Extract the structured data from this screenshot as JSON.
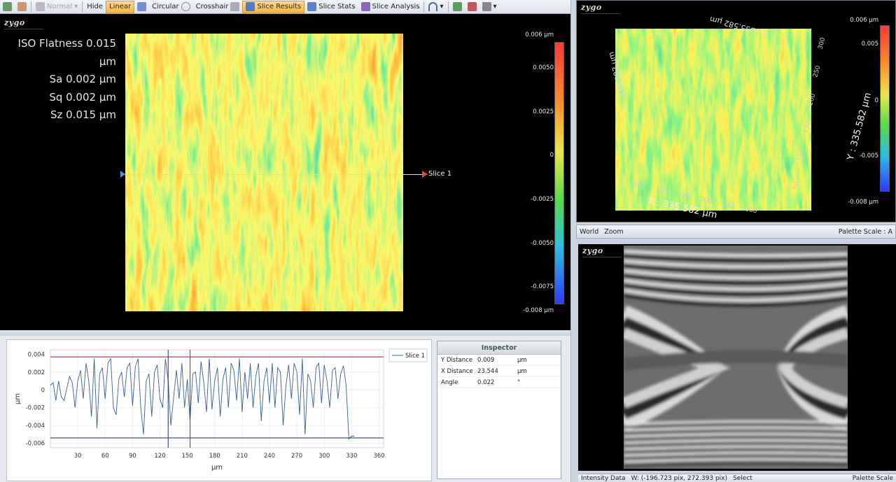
{
  "toolbar": {
    "normal_label": "Normal",
    "hide_label": "Hide",
    "linear_label": "Linear",
    "circular_label": "Circular",
    "crosshair_label": "Crosshair",
    "slice_results_label": "Slice Results",
    "slice_stats_label": "Slice Stats",
    "slice_analysis_label": "Slice Analysis"
  },
  "view2d": {
    "logo": "zygo",
    "stats": [
      "ISO Flatness 0.015 µm",
      "Sa 0.002 µm",
      "Sq 0.002 µm",
      "Sz 0.015 µm"
    ],
    "slice_label": "Slice 1",
    "colorbar_labels": [
      "0.006 µm",
      "0.0050",
      "0.0025",
      "0",
      "-0.0025",
      "-0.0050",
      "-0.0075",
      "-0.008 µm"
    ]
  },
  "view3d": {
    "logo": "zygo",
    "x_axis_title": "X : 335.582 µm",
    "y_axis_title": "Y : 335.582 µm",
    "x_ticks": [
      "50",
      "100",
      "150",
      "200",
      "250",
      "300"
    ],
    "y_ticks": [
      "50",
      "100",
      "150",
      "200",
      "250",
      "300"
    ],
    "colorbar_labels": [
      "0.006 µm",
      "0.005",
      "0",
      "-0.005",
      "-0.008 µm"
    ],
    "status": {
      "world": "World",
      "zoom": "Zoom",
      "palette": "Palette Scale : A"
    }
  },
  "intensity": {
    "logo": "zygo",
    "status": {
      "label": "Intensity Data",
      "coords": "W: (-196.723 pix, 272.393 pix)",
      "select": "Select",
      "palette": "Palette Scale"
    }
  },
  "inspector": {
    "title": "Inspector",
    "rows": [
      {
        "name": "Y Distance",
        "value": "0.009",
        "unit": "µm"
      },
      {
        "name": "X Distance",
        "value": "23.544",
        "unit": "µm"
      },
      {
        "name": "Angle",
        "value": "0.022",
        "unit": "°"
      }
    ]
  },
  "chart_data": {
    "type": "line",
    "title": "",
    "xlabel": "µm",
    "ylabel": "µm",
    "xlim": [
      0,
      365
    ],
    "ylim": [
      -0.0065,
      0.0045
    ],
    "x_ticks": [
      30,
      60,
      90,
      120,
      150,
      180,
      210,
      240,
      270,
      300,
      330,
      360
    ],
    "y_ticks": [
      0.004,
      0.002,
      0,
      -0.002,
      -0.004,
      -0.006
    ],
    "y_tick_labels": [
      "0.004",
      "0.002",
      "0",
      "-0.002",
      "-0.004",
      "-0.006"
    ],
    "x_tick_labels": [
      "30",
      "60",
      "90",
      "120",
      "150",
      "180",
      "210",
      "240",
      "270",
      "300",
      "330",
      "360"
    ],
    "legend": {
      "position": "top-right",
      "entries": [
        "Slice 1"
      ]
    },
    "grid": true,
    "cursors": {
      "horizontal": [
        0.0037,
        -0.0054
      ],
      "vertical": [
        129,
        153
      ]
    },
    "series": [
      {
        "name": "Slice 1",
        "x": [
          0,
          3,
          6,
          9,
          12,
          15,
          18,
          21,
          24,
          27,
          30,
          33,
          36,
          39,
          42,
          45,
          48,
          51,
          54,
          57,
          60,
          63,
          66,
          69,
          72,
          75,
          78,
          81,
          84,
          87,
          90,
          93,
          96,
          99,
          102,
          105,
          108,
          111,
          114,
          117,
          120,
          123,
          126,
          129,
          132,
          135,
          138,
          141,
          144,
          147,
          150,
          153,
          156,
          159,
          162,
          165,
          168,
          171,
          174,
          177,
          180,
          183,
          186,
          189,
          192,
          195,
          198,
          201,
          204,
          207,
          210,
          213,
          216,
          219,
          222,
          225,
          228,
          231,
          234,
          237,
          240,
          243,
          246,
          249,
          252,
          255,
          258,
          261,
          264,
          267,
          270,
          273,
          276,
          279,
          282,
          285,
          288,
          291,
          294,
          297,
          300,
          303,
          306,
          309,
          312,
          315,
          318,
          321,
          324,
          327,
          330,
          333
        ],
        "values": [
          0.0005,
          0.0008,
          -0.0012,
          0.001,
          -0.0008,
          -0.0012,
          0.0002,
          0.0015,
          0.0008,
          -0.002,
          0.001,
          0.0022,
          -0.001,
          0.003,
          0.001,
          -0.003,
          0.0035,
          -0.0043,
          0.0018,
          0.0025,
          -0.001,
          0.003,
          0.0035,
          -0.002,
          -0.0028,
          0.0012,
          0.002,
          -0.0008,
          0.0025,
          0.003,
          -0.0018,
          0.0026,
          0.0035,
          -0.002,
          -0.005,
          0.001,
          0.0018,
          -0.003,
          0.002,
          0.0028,
          -0.001,
          -0.002,
          0.0035,
          0.001,
          -0.004,
          -0.0008,
          0.0022,
          -0.001,
          0.003,
          -0.002,
          0.0012,
          -0.0035,
          0.0018,
          0.002,
          -0.0015,
          0.0032,
          0.0008,
          -0.0025,
          0.0035,
          -0.0022,
          0.001,
          0.0025,
          -0.003,
          0.0012,
          0.0025,
          -0.002,
          0.003,
          0.0022,
          -0.0012,
          0.0035,
          -0.0025,
          0.002,
          -0.001,
          0.003,
          -0.002,
          0.0015,
          0.003,
          -0.0035,
          0.001,
          0.0025,
          -0.0015,
          0.003,
          -0.002,
          0.0025,
          0.002,
          -0.004,
          0.0005,
          0.0028,
          -0.001,
          0.003,
          0.002,
          -0.0028,
          0.0035,
          -0.005,
          0.0018,
          0.001,
          -0.002,
          0.0025,
          0.003,
          -0.0015,
          0.0028,
          0.001,
          -0.002,
          0.0022,
          0.0025,
          -0.001,
          0.0018,
          0.0027,
          0.0005,
          -0.0055,
          -0.0052,
          -0.0052
        ]
      }
    ]
  }
}
